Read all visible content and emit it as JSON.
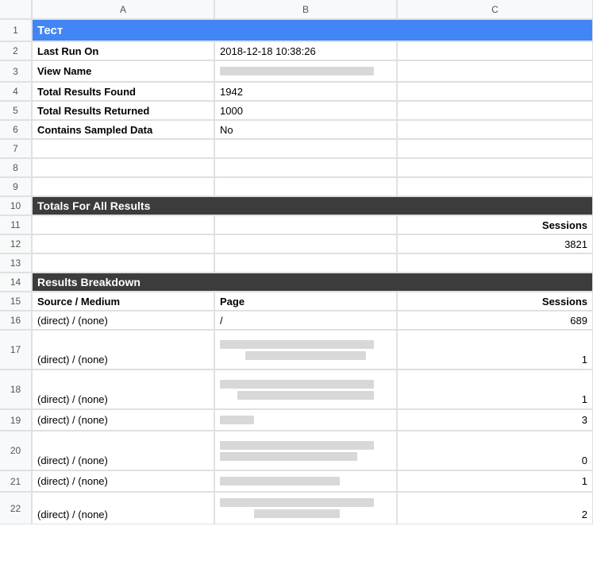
{
  "columns": [
    "A",
    "B",
    "C"
  ],
  "rows": [
    "1",
    "2",
    "3",
    "4",
    "5",
    "6",
    "7",
    "8",
    "9",
    "10",
    "11",
    "12",
    "13",
    "14",
    "15",
    "16",
    "17",
    "18",
    "19",
    "20",
    "21",
    "22"
  ],
  "title": "Тест",
  "meta": {
    "last_run_label": "Last Run On",
    "last_run_value": "2018-12-18 10:38:26",
    "view_name_label": "View Name",
    "total_found_label": "Total Results Found",
    "total_found_value": "1942",
    "total_returned_label": "Total Results Returned",
    "total_returned_value": "1000",
    "sampled_label": "Contains Sampled Data",
    "sampled_value": "No"
  },
  "totals_header": "Totals For All Results",
  "sessions_label": "Sessions",
  "totals_sessions": "3821",
  "breakdown_header": "Results Breakdown",
  "breakdown_cols": {
    "a": "Source / Medium",
    "b": "Page",
    "c": "Sessions"
  },
  "breakdown": {
    "r16": {
      "source": "(direct) / (none)",
      "page": "/",
      "sessions": "689"
    },
    "r17": {
      "source": "(direct) / (none)",
      "sessions": "1"
    },
    "r18": {
      "source": "(direct) / (none)",
      "sessions": "1"
    },
    "r19": {
      "source": "(direct) / (none)",
      "sessions": "3"
    },
    "r20": {
      "source": "(direct) / (none)",
      "sessions": "0"
    },
    "r21": {
      "source": "(direct) / (none)",
      "sessions": "1"
    },
    "r22": {
      "source": "(direct) / (none)",
      "sessions": "2"
    }
  }
}
